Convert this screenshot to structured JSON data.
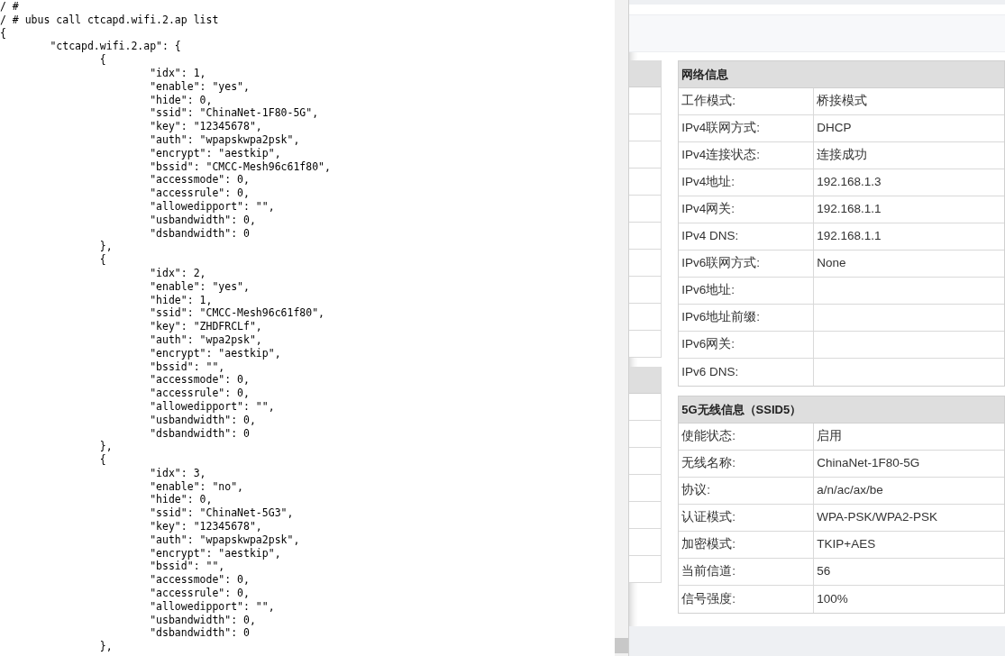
{
  "terminal": {
    "lines": [
      "/ #",
      "/ # ubus call ctcapd.wifi.2.ap list",
      "{",
      "\t\"ctcapd.wifi.2.ap\": {",
      "\t\t{",
      "\t\t\t\"idx\": 1,",
      "\t\t\t\"enable\": \"yes\",",
      "\t\t\t\"hide\": 0,",
      "\t\t\t\"ssid\": \"ChinaNet-1F80-5G\",",
      "\t\t\t\"key\": \"12345678\",",
      "\t\t\t\"auth\": \"wpapskwpa2psk\",",
      "\t\t\t\"encrypt\": \"aestkip\",",
      "\t\t\t\"bssid\": \"CMCC-Mesh96c61f80\",",
      "\t\t\t\"accessmode\": 0,",
      "\t\t\t\"accessrule\": 0,",
      "\t\t\t\"allowedipport\": \"\",",
      "\t\t\t\"usbandwidth\": 0,",
      "\t\t\t\"dsbandwidth\": 0",
      "\t\t},",
      "\t\t{",
      "\t\t\t\"idx\": 2,",
      "\t\t\t\"enable\": \"yes\",",
      "\t\t\t\"hide\": 1,",
      "\t\t\t\"ssid\": \"CMCC-Mesh96c61f80\",",
      "\t\t\t\"key\": \"ZHDFRCLf\",",
      "\t\t\t\"auth\": \"wpa2psk\",",
      "\t\t\t\"encrypt\": \"aestkip\",",
      "\t\t\t\"bssid\": \"\",",
      "\t\t\t\"accessmode\": 0,",
      "\t\t\t\"accessrule\": 0,",
      "\t\t\t\"allowedipport\": \"\",",
      "\t\t\t\"usbandwidth\": 0,",
      "\t\t\t\"dsbandwidth\": 0",
      "\t\t},",
      "\t\t{",
      "\t\t\t\"idx\": 3,",
      "\t\t\t\"enable\": \"no\",",
      "\t\t\t\"hide\": 0,",
      "\t\t\t\"ssid\": \"ChinaNet-5G3\",",
      "\t\t\t\"key\": \"12345678\",",
      "\t\t\t\"auth\": \"wpapskwpa2psk\",",
      "\t\t\t\"encrypt\": \"aestkip\",",
      "\t\t\t\"bssid\": \"\",",
      "\t\t\t\"accessmode\": 0,",
      "\t\t\t\"accessrule\": 0,",
      "\t\t\t\"allowedipport\": \"\",",
      "\t\t\t\"usbandwidth\": 0,",
      "\t\t\t\"dsbandwidth\": 0",
      "\t\t},"
    ]
  },
  "sections": [
    {
      "title": "网络信息",
      "rows": [
        {
          "label": "工作模式:",
          "value": "桥接模式"
        },
        {
          "label": "IPv4联网方式:",
          "value": "DHCP"
        },
        {
          "label": "IPv4连接状态:",
          "value": "连接成功"
        },
        {
          "label": "IPv4地址:",
          "value": "192.168.1.3"
        },
        {
          "label": "IPv4网关:",
          "value": "192.168.1.1"
        },
        {
          "label": "IPv4 DNS:",
          "value": "192.168.1.1"
        },
        {
          "label": "IPv6联网方式:",
          "value": "None"
        },
        {
          "label": "IPv6地址:"
        },
        {
          "label": "IPv6地址前缀:"
        },
        {
          "label": "IPv6网关:"
        },
        {
          "label": "IPv6 DNS:"
        }
      ]
    },
    {
      "title": "5G无线信息（SSID5）",
      "rows": [
        {
          "label": "使能状态:",
          "value": "启用"
        },
        {
          "label": "无线名称:",
          "value": "ChinaNet-1F80-5G"
        },
        {
          "label": "协议:",
          "value": "a/n/ac/ax/be"
        },
        {
          "label": "认证模式:",
          "value": "WPA-PSK/WPA2-PSK"
        },
        {
          "label": "加密模式:",
          "value": "TKIP+AES"
        },
        {
          "label": "当前信道:",
          "value": "56"
        },
        {
          "label": "信号强度:",
          "value": "100%"
        }
      ]
    }
  ]
}
